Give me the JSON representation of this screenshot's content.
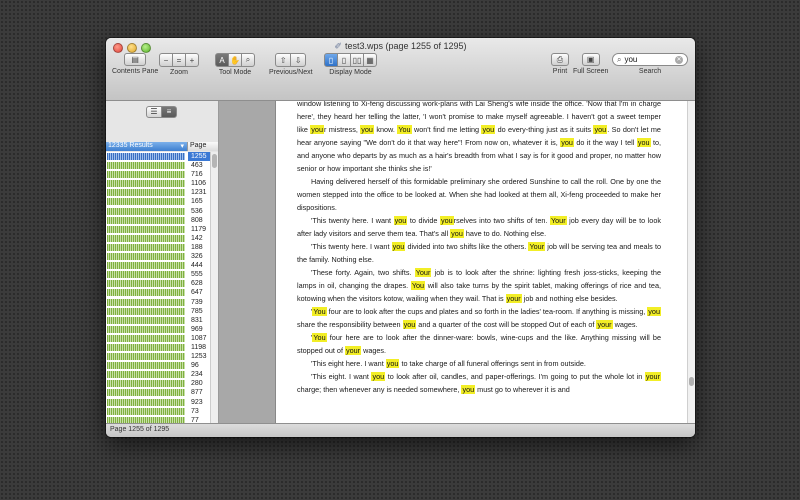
{
  "window": {
    "title": "test3.wps (page 1255 of 1295)",
    "doc_icon": "document-icon"
  },
  "toolbar": {
    "contents_pane": "Contents Pane",
    "zoom": "Zoom",
    "tool_mode": "Tool Mode",
    "prev_next": "Previous/Next",
    "display_mode": "Display Mode",
    "print": "Print",
    "full_screen": "Full Screen",
    "search_label": "Search",
    "search_value": "you"
  },
  "sidebar": {
    "results_header": "12335 Results",
    "page_header": "Page",
    "pages": [
      "1255",
      "463",
      "716",
      "1106",
      "1231",
      "165",
      "536",
      "808",
      "1179",
      "142",
      "188",
      "326",
      "444",
      "555",
      "628",
      "647",
      "739",
      "785",
      "831",
      "969",
      "1087",
      "1198",
      "1253",
      "96",
      "234",
      "280",
      "877",
      "923",
      "73",
      "77",
      "257"
    ]
  },
  "status": "Page 1255 of 1295",
  "document": {
    "paragraphs": [
      {
        "indent": false,
        "html": "window listening to Xi-feng discussing work-plans with Lai Sheng's wife inside the office. 'Now that I'm in charge here', they heard her telling the latter, 'I won't promise to make myself agreeable. I haven't got a sweet temper like <mark>you</mark>r mistress, <mark>you</mark> know. <mark>You</mark> won't find me letting <mark>you</mark> do every-thing just as it suits <mark>you</mark>. So don't let me hear anyone saying \"We don't do it that way here\"! From now on, whatever it is, <mark>you</mark> do it the way I tell <mark>you</mark> to, and anyone who departs by as much as a hair's breadth from what I say is for it good and proper, no matter how senior or how important she thinks she is!'"
      },
      {
        "indent": true,
        "html": "Having delivered herself of this formidable preliminary she ordered Sunshine to call the roll. One by one the women stepped into the office to be looked at. When she had looked at them all, Xi-feng proceeded to make her dispositions."
      },
      {
        "indent": true,
        "html": "'This twenty here. I want <mark>you</mark> to divide <mark>you</mark>rselves into two shifts of ten. <mark>Your</mark> job every day will be to look after lady visitors and serve them tea. That's all <mark>you</mark> have to do. Nothing else."
      },
      {
        "indent": true,
        "html": "'This twenty here. I want <mark>you</mark> divided into two shifts like the others. <mark>Your</mark> job will be serving tea and meals to the family. Nothing else."
      },
      {
        "indent": true,
        "html": "'These forty. Again, two shifts. <mark>Your</mark> job is to look after the shrine: lighting fresh joss-sticks, keeping the lamps in oil, changing the drapes. <mark>You</mark> will also take turns by the spirit tablet, making offerings of rice and tea, kotowing when the visitors kotow, wailing when they wail. That is <mark>your</mark> job and nothing else besides."
      },
      {
        "indent": true,
        "html": "'<mark>You</mark> four are to look after the cups and plates and so forth in the ladies' tea-room. If anything is missing, <mark>you</mark> share the responsibility between <mark>you</mark> and a quarter of the cost will be stopped Out of each of <mark>your</mark> wages."
      },
      {
        "indent": true,
        "html": "'<mark>You</mark> four here are to look after the dinner-ware: bowls, wine-cups and the like. Anything missing will be stopped out of <mark>your</mark> wages."
      },
      {
        "indent": true,
        "html": "'This eight here. I want <mark>you</mark> to take charge of all funeral offerings sent in from outside."
      },
      {
        "indent": true,
        "html": "'This eight. I want <mark>you</mark> to look after oil, candles, and paper-offerings. I'm going to put the whole lot in <mark>your</mark> charge; then whenever any is needed somewhere, <mark>you</mark> must go to wherever it is and"
      }
    ]
  }
}
